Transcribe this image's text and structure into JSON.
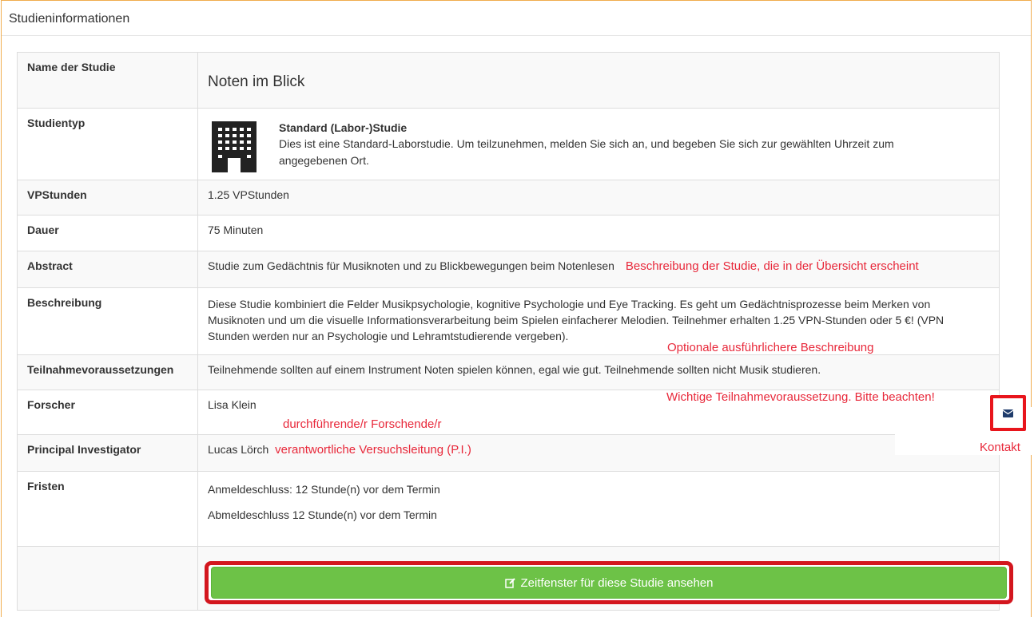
{
  "panel": {
    "title": "Studieninformationen"
  },
  "rows": {
    "name": {
      "label": "Name der Studie",
      "value": "Noten im Blick"
    },
    "type": {
      "label": "Studientyp",
      "title": "Standard (Labor-)Studie",
      "description": "Dies ist eine Standard-Laborstudie. Um teilzunehmen, melden Sie sich an, und begeben Sie sich zur gewählten Uhrzeit zum angegebenen Ort.",
      "icon": "building-icon"
    },
    "hours": {
      "label": "VPStunden",
      "value": "1.25 VPStunden"
    },
    "duration": {
      "label": "Dauer",
      "value": "75 Minuten"
    },
    "abstract": {
      "label": "Abstract",
      "value": "Studie zum Gedächtnis für Musiknoten und zu Blickbewegungen beim Notenlesen"
    },
    "description": {
      "label": "Beschreibung",
      "value": "Diese Studie kombiniert die Felder Musikpsychologie, kognitive Psychologie und Eye Tracking. Es geht um Gedächtnisprozesse beim Merken von Musiknoten und um die visuelle Informationsverarbeitung beim Spielen einfacherer Melodien. Teilnehmer erhalten 1.25 VPN-Stunden oder 5 €! (VPN Stunden werden nur an Psychologie und Lehramtstudierende vergeben)."
    },
    "requirements": {
      "label": "Teilnahmevoraussetzungen",
      "value": "Teilnehmende sollten auf einem Instrument Noten spielen können, egal wie gut. Teilnehmende sollten nicht Musik studieren."
    },
    "researcher": {
      "label": "Forscher",
      "value": "Lisa Klein"
    },
    "pi": {
      "label": "Principal Investigator",
      "value": "Lucas Lörch"
    },
    "deadlines": {
      "label": "Fristen",
      "signup": "Anmeldeschluss:  12 Stunde(n) vor dem Termin",
      "signoff": "Abmeldeschluss  12 Stunde(n) vor dem Termin"
    }
  },
  "annotations": {
    "abstract": "Beschreibung der Studie, die in der Übersicht erscheint",
    "description": "Optionale ausführlichere Beschreibung",
    "requirements": "Wichtige Teilnahmevoraussetzung. Bitte beachten!",
    "researcher": "durchführende/r Forschende/r",
    "pi": "verantwortliche Versuchsleitung (P.I.)",
    "contact": "Kontakt"
  },
  "action": {
    "label": "Zeitfenster für diese Studie ansehen",
    "icon": "edit-icon",
    "color": "#6dc247"
  },
  "colors": {
    "annotation": "#e8283a",
    "highlight": "#d3161e",
    "panel_border": "#f0ad4e"
  }
}
